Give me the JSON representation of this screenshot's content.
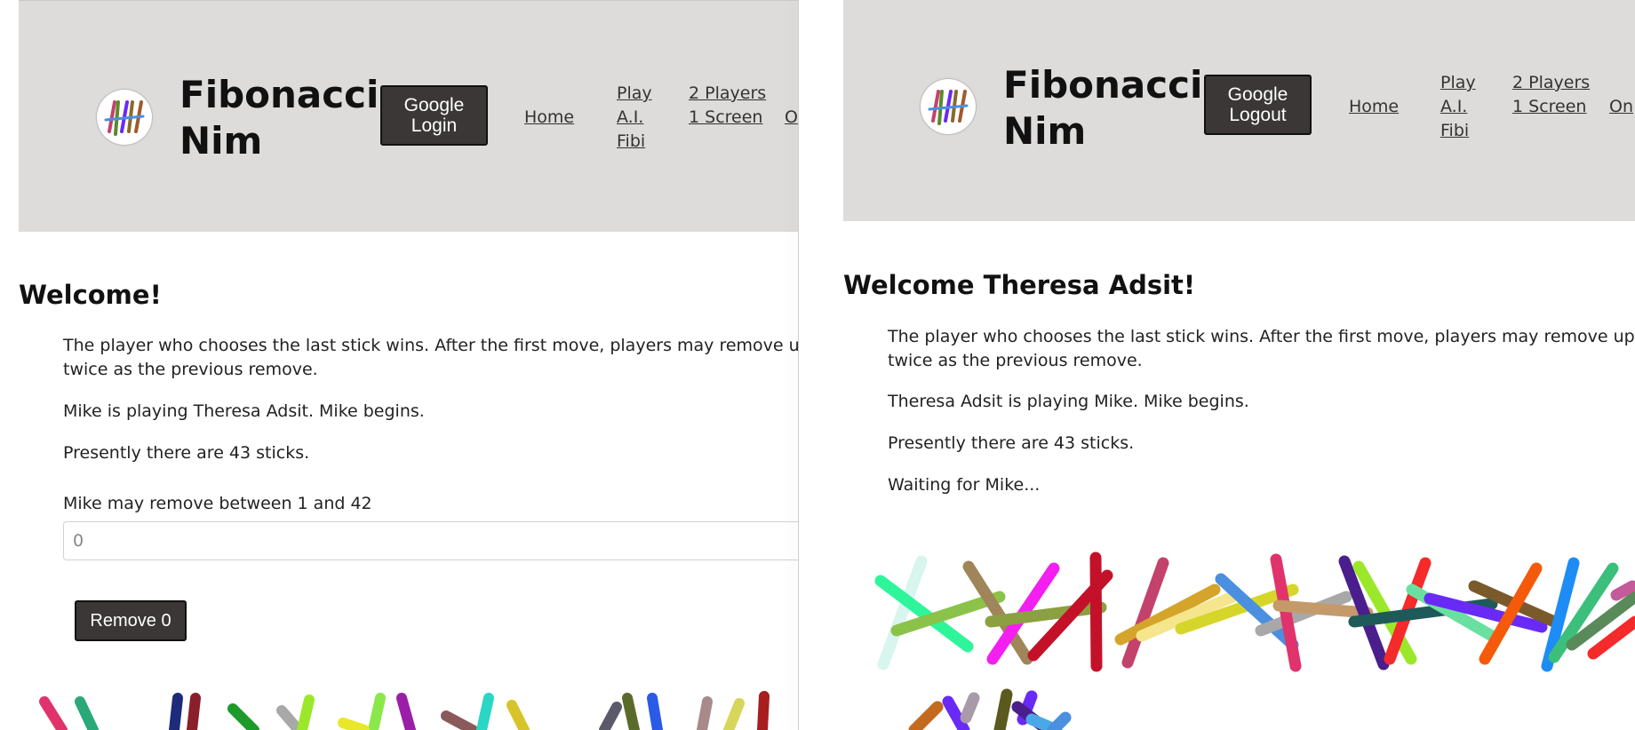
{
  "left": {
    "brand": "Fibonacci Nim",
    "auth_button": "Google Login",
    "nav": [
      "Home",
      "Play A.I. Fibi",
      "2 Players 1 Screen",
      "On"
    ],
    "heading": "Welcome!",
    "rules": "The player who chooses the last stick wins. After the first move, players may remove up to twice as the previous remove.",
    "matchup": "Mike is playing Theresa Adsit. Mike begins.",
    "count": "Presently there are 43 sticks.",
    "prompt": "Mike may remove between 1 and 42",
    "input_placeholder": "0",
    "remove_button": "Remove 0"
  },
  "right": {
    "brand": "Fibonacci Nim",
    "auth_button": "Google Logout",
    "nav": [
      "Home",
      "Play A.I. Fibi",
      "2 Players 1 Screen",
      "On"
    ],
    "heading": "Welcome Theresa Adsit!",
    "rules": "The player who chooses the last stick wins. After the first move, players may remove up to twice as the previous remove.",
    "matchup": "Theresa Adsit is playing Mike. Mike begins.",
    "count": "Presently there are 43 sticks.",
    "status": "Waiting for Mike..."
  },
  "stick_colors": [
    "#2ef59a",
    "#8bc34a",
    "#a0855b",
    "#f41ef0",
    "#c4112a",
    "#c2426b",
    "#d4a52a",
    "#f5e58c",
    "#4a8fe0",
    "#d6d62a",
    "#a8a8a8",
    "#e0336b",
    "#4a1e8c",
    "#9be82a",
    "#1e5a5a",
    "#f52a2a",
    "#6a2af5",
    "#f55a0a",
    "#1e8cf5",
    "#7a5a2a",
    "#3bbf7a"
  ]
}
